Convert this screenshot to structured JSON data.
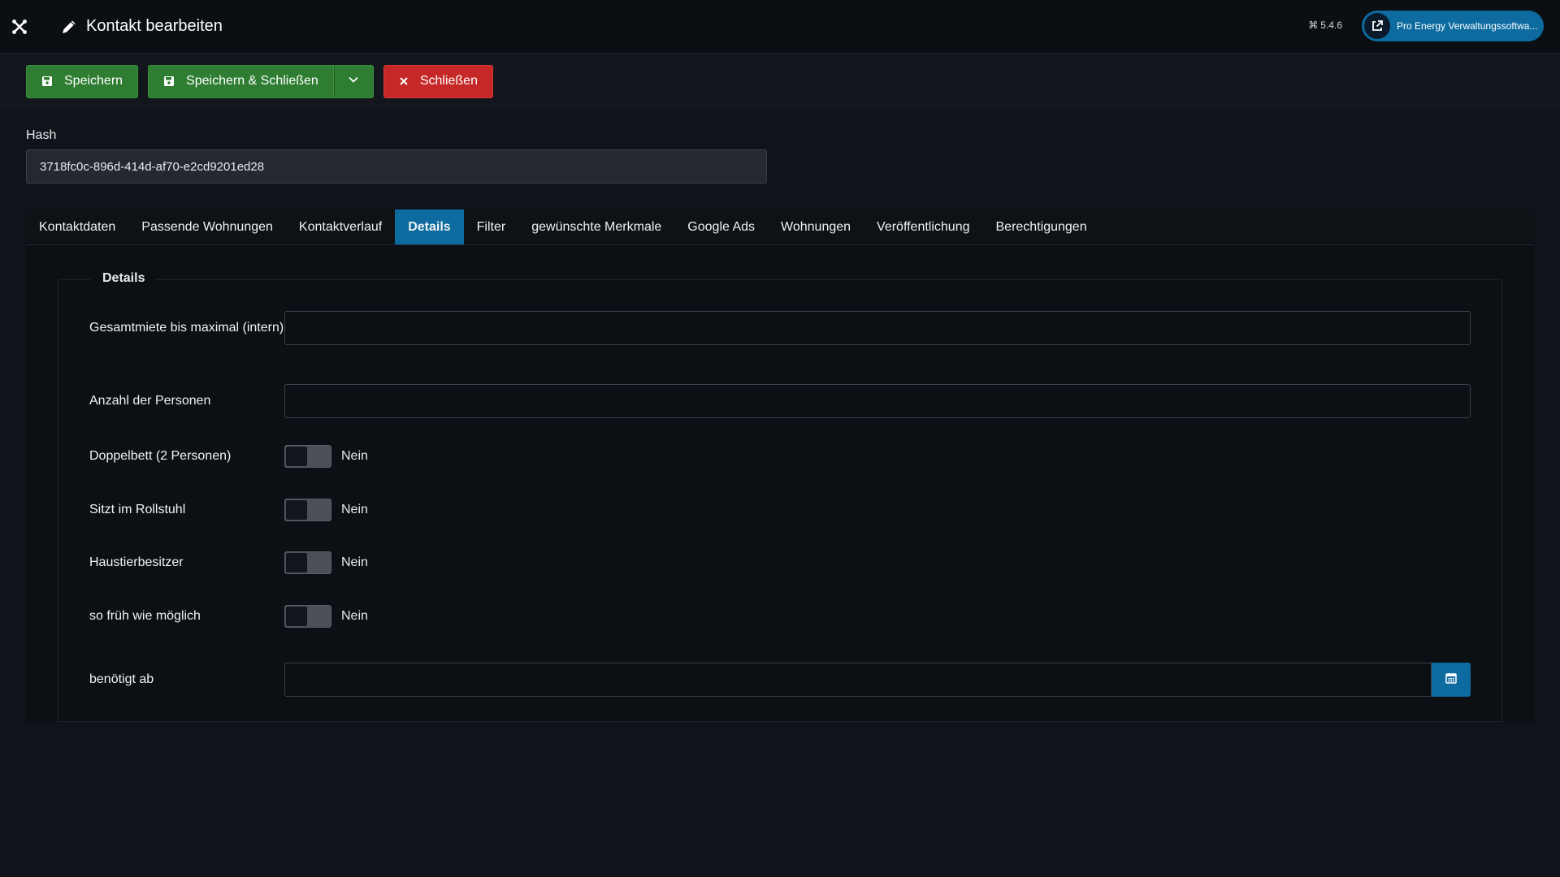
{
  "header": {
    "title": "Kontakt bearbeiten",
    "version": "5.4.6",
    "site_button": "Pro Energy Verwaltungssoftwa..."
  },
  "toolbar": {
    "save_label": "Speichern",
    "save_close_label": "Speichern & Schließen",
    "close_label": "Schließen"
  },
  "hash": {
    "label": "Hash",
    "value": "3718fc0c-896d-414d-af70-e2cd9201ed28"
  },
  "tabs": [
    {
      "label": "Kontaktdaten"
    },
    {
      "label": "Passende Wohnungen"
    },
    {
      "label": "Kontaktverlauf"
    },
    {
      "label": "Details"
    },
    {
      "label": "Filter"
    },
    {
      "label": "gewünschte Merkmale"
    },
    {
      "label": "Google Ads"
    },
    {
      "label": "Wohnungen"
    },
    {
      "label": "Veröffentlichung"
    },
    {
      "label": "Berechtigungen"
    }
  ],
  "active_tab": "Details",
  "details": {
    "legend": "Details",
    "fields": {
      "max_rent_label": "Gesamtmiete bis maximal (intern)",
      "persons_label": "Anzahl der Personen",
      "double_bed_label": "Doppelbett (2 Personen)",
      "wheelchair_label": "Sitzt im Rollstuhl",
      "pet_owner_label": "Haustierbesitzer",
      "asap_label": "so früh wie möglich",
      "needed_from_label": "benötigt ab"
    },
    "toggle_off_text": "Nein"
  },
  "colors": {
    "accent": "#0d6ba0",
    "success": "#2e7d32",
    "danger": "#c62828",
    "background": "#101319"
  }
}
